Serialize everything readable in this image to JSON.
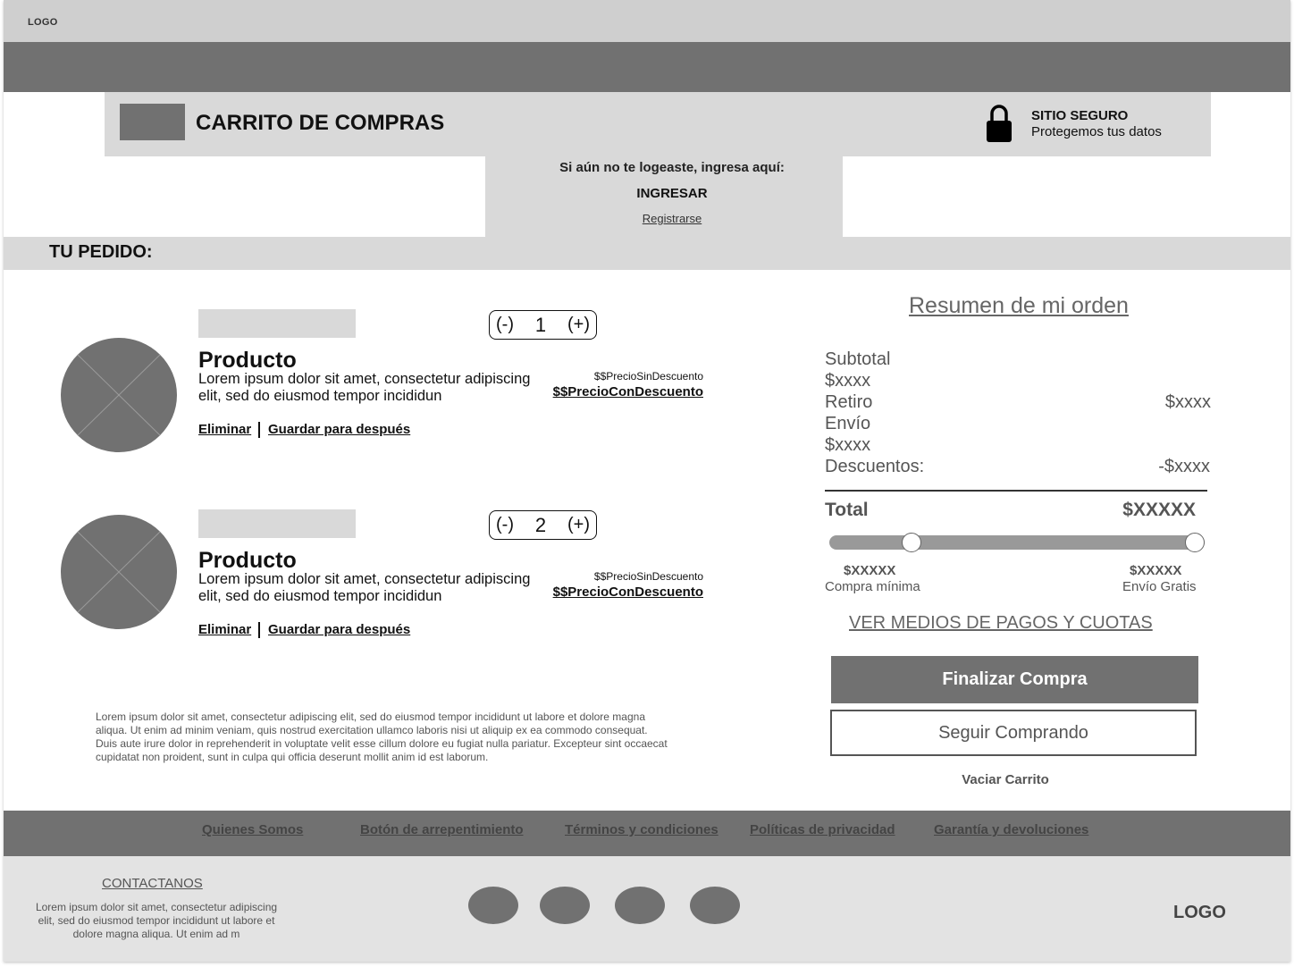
{
  "header": {
    "logo": "LOGO",
    "title": "CARRITO DE COMPRAS",
    "secure_title": "SITIO SEGURO",
    "secure_subtitle": "Protegemos tus datos"
  },
  "login": {
    "prompt": "Si aún no te logeaste, ingresa aquí:",
    "login_label": "INGRESAR",
    "register_label": "Registrarse"
  },
  "order": {
    "heading": "TU PEDIDO:",
    "items": [
      {
        "name": "Producto",
        "description": "Lorem ipsum dolor sit amet, consectetur adipiscing elit, sed do eiusmod tempor incididun",
        "quantity": "1",
        "minus": "(-)",
        "plus": "(+)",
        "price_old": "$$PrecioSinDescuento",
        "price_new": "$$PrecioConDescuento",
        "remove_label": "Eliminar",
        "save_label": "Guardar para después"
      },
      {
        "name": "Producto",
        "description": "Lorem ipsum dolor sit amet, consectetur adipiscing elit, sed do eiusmod tempor incididun",
        "quantity": "2",
        "minus": "(-)",
        "plus": "(+)",
        "price_old": "$$PrecioSinDescuento",
        "price_new": "$$PrecioConDescuento",
        "remove_label": "Eliminar",
        "save_label": "Guardar para después"
      }
    ],
    "disclaimer": "Lorem ipsum dolor sit amet, consectetur adipiscing elit, sed do eiusmod tempor incididunt ut labore et dolore magna aliqua. Ut enim ad minim veniam, quis nostrud exercitation ullamco laboris nisi ut aliquip ex ea commodo consequat. Duis aute irure dolor in reprehenderit in voluptate velit esse cillum dolore eu fugiat nulla pariatur. Excepteur sint occaecat cupidatat non proident, sunt in culpa qui officia deserunt mollit anim id est laborum."
  },
  "summary": {
    "title": "Resumen de mi orden",
    "subtotal_label": "Subtotal",
    "subtotal_value": "$xxxx",
    "retiro_label": "Retiro",
    "retiro_value": "$xxxx",
    "envio_label": "Envío",
    "envio_value": "$xxxx",
    "descuentos_label": "Descuentos:",
    "descuentos_value": "-$xxxx",
    "total_label": "Total",
    "total_value": "$XXXXX",
    "min_amount": "$XXXXX",
    "min_caption": "Compra mínima",
    "free_amount": "$XXXXX",
    "free_caption": "Envío Gratis",
    "progress_fraction": 0.22,
    "payment_link": "VER MEDIOS DE PAGOS Y CUOTAS",
    "checkout_label": "Finalizar Compra",
    "continue_label": "Seguir Comprando",
    "empty_label": "Vaciar Carrito"
  },
  "footer": {
    "links": [
      "Quienes Somos",
      "Botón de arrepentimiento",
      "Términos y condiciones",
      "Políticas de privacidad",
      "Garantía y devoluciones"
    ],
    "contact_title": "CONTACTANOS",
    "contact_text": "Lorem ipsum dolor sit amet, consectetur adipiscing elit, sed do eiusmod tempor incididunt ut labore et dolore magna aliqua. Ut enim ad m",
    "logo": "LOGO"
  },
  "colors": {
    "dark_gray": "#717171",
    "light_gray": "#d9d9d9",
    "top_gray": "#cfcfcf"
  }
}
